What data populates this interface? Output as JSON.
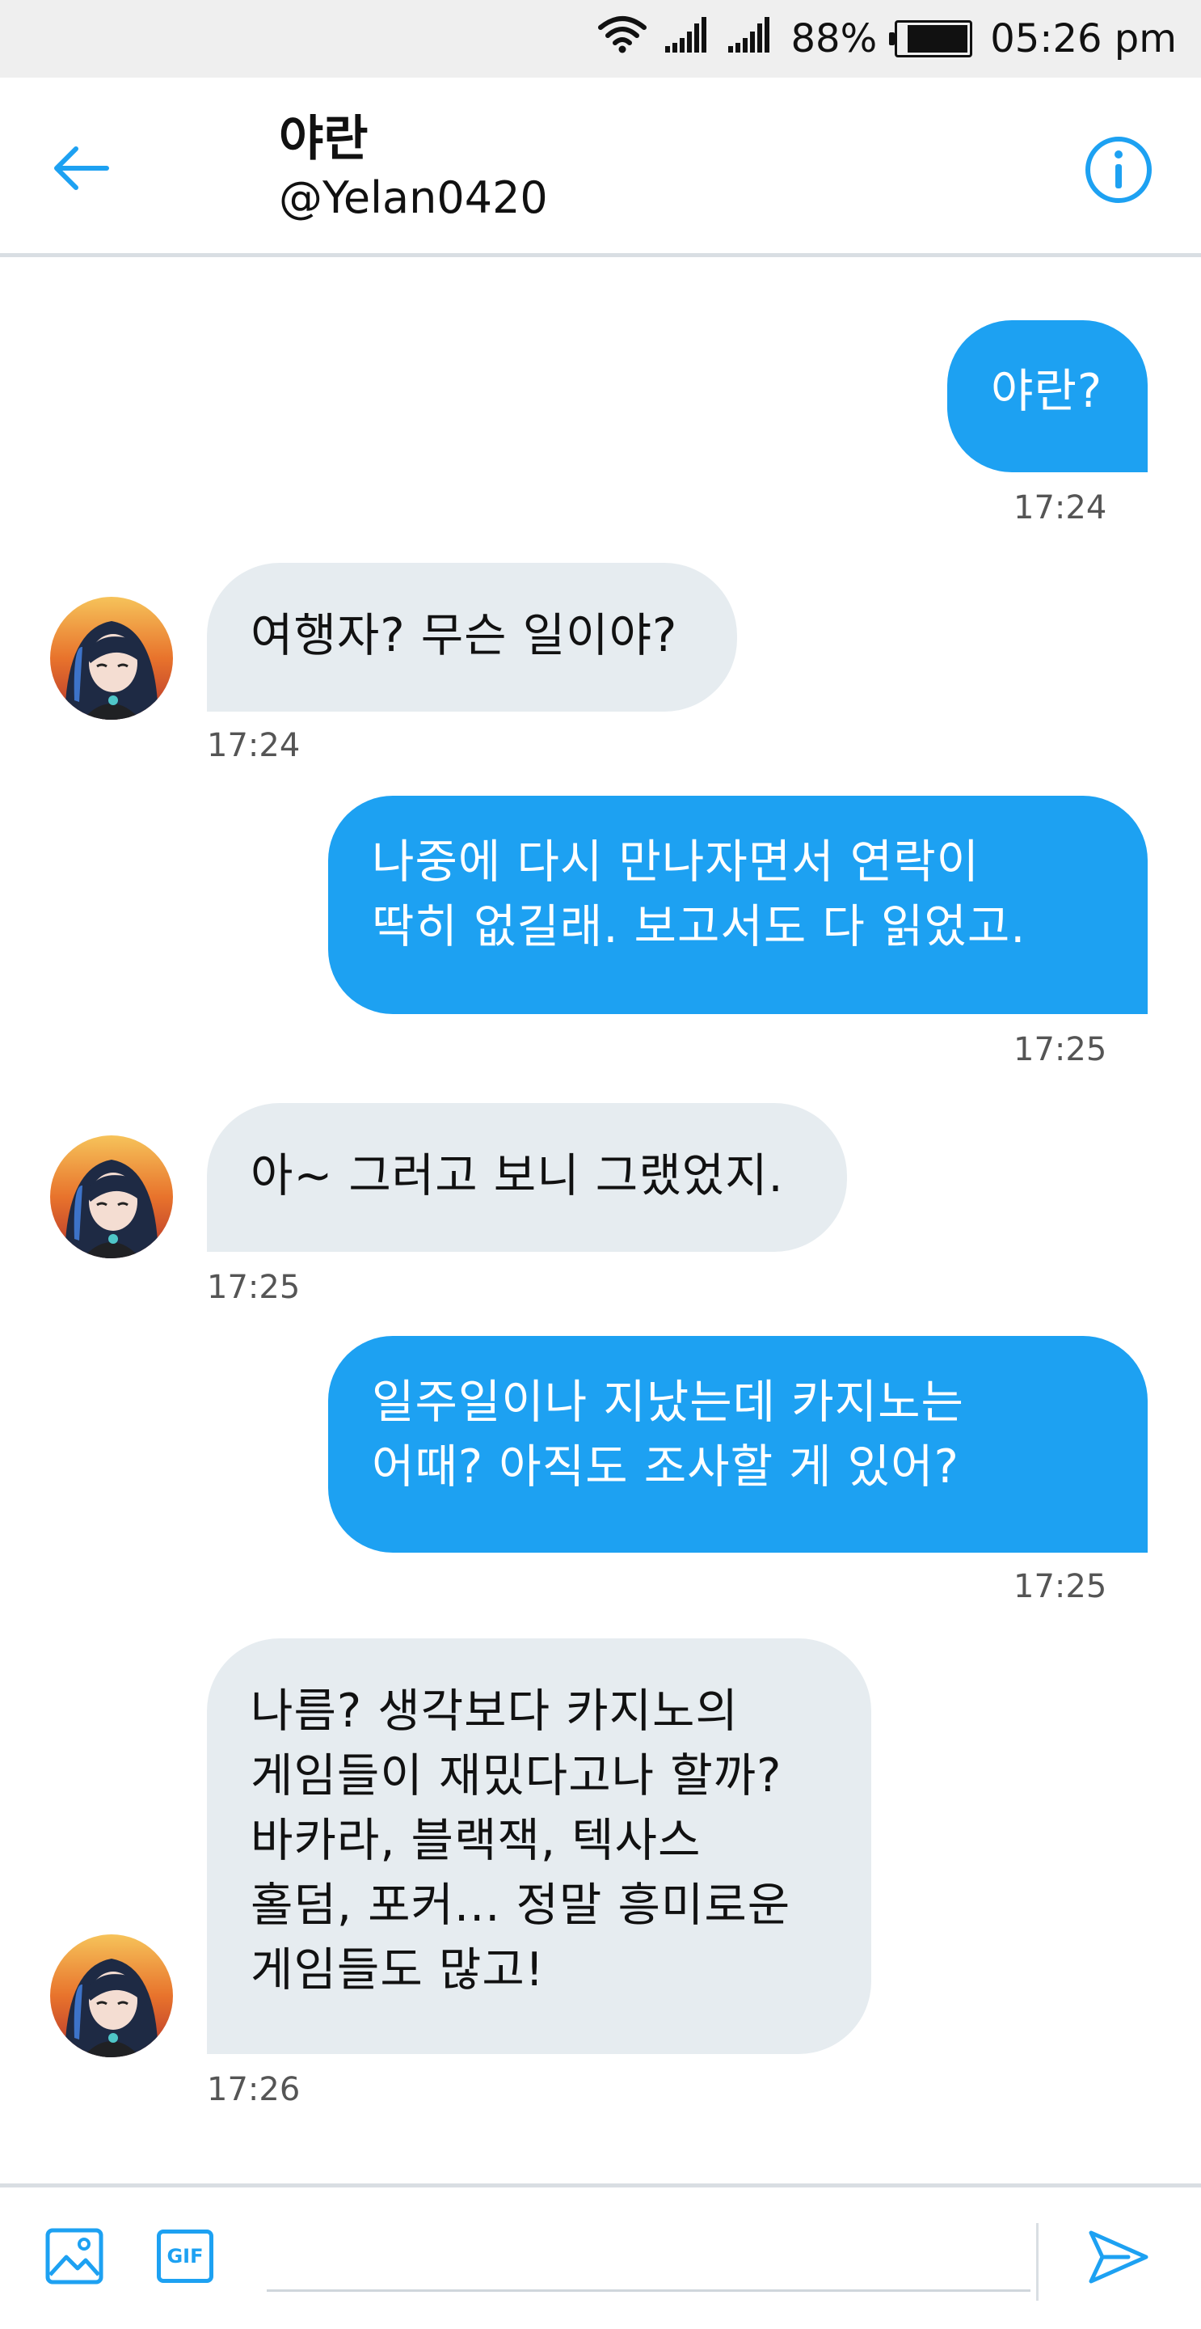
{
  "status_bar": {
    "battery_percent": "88%",
    "battery_level": 0.88,
    "time": "05:26 pm",
    "icons": [
      "wifi-icon",
      "signal-icon",
      "signal-icon",
      "battery-icon"
    ]
  },
  "header": {
    "name": "야란",
    "handle": "@Yelan0420",
    "back_icon": "arrow-left-icon",
    "info_icon": "info-icon",
    "accent_color": "#1da1f2"
  },
  "messages": [
    {
      "sender": "me",
      "lines": [
        "야란?"
      ],
      "time": "17:24"
    },
    {
      "sender": "contact",
      "lines": [
        "여행자? 무슨 일이야?"
      ],
      "time": "17:24"
    },
    {
      "sender": "me",
      "lines": [
        "나중에 다시 만나자면서 연락이",
        "딱히 없길래. 보고서도 다 읽었고."
      ],
      "time": "17:25"
    },
    {
      "sender": "contact",
      "lines": [
        "아~ 그러고 보니 그랬었지."
      ],
      "time": "17:25"
    },
    {
      "sender": "me",
      "lines": [
        "일주일이나 지났는데 카지노는",
        "어때? 아직도 조사할 게 있어?"
      ],
      "time": "17:25"
    },
    {
      "sender": "contact",
      "lines": [
        "나름? 생각보다 카지노의",
        "게임들이 재밌다고나 할까?",
        "바카라, 블랙잭, 텍사스",
        "홀덤, 포커... 정말 흥미로운",
        "게임들도 많고!"
      ],
      "time": "17:26"
    }
  ],
  "composer": {
    "image_icon": "image-icon",
    "gif_label": "GIF",
    "send_icon": "send-icon",
    "placeholder": ""
  }
}
